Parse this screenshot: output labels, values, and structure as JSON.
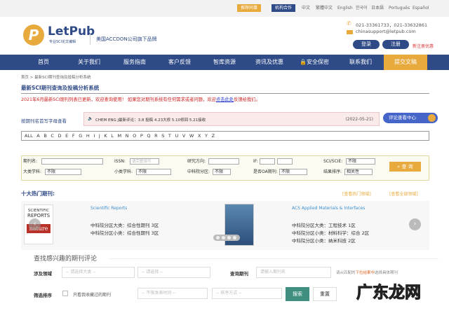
{
  "topbar": {
    "recommend": "推荐同事",
    "institution": "机构合作",
    "langs": [
      "中文",
      "繁體中文",
      "English",
      "한국어",
      "日本語",
      "Português",
      "Español"
    ]
  },
  "header": {
    "logo": "LetPub",
    "logo_sub": "专业SCI论文编辑",
    "brand": "美国ACCDON公司旗下品牌",
    "phone": "021-33361733，021-33632861",
    "email": "chinasupport@letpub.com",
    "login": "登录",
    "register": "注册",
    "promo": "新注册优惠"
  },
  "nav": [
    "首页",
    "关于我们",
    "服务指南",
    "客户反馈",
    "智库资源",
    "资讯及优惠",
    "安全保密",
    "联系我们",
    "提交文稿"
  ],
  "breadcrumb": "首页 > 最新SCI期刊查询及投稿分析系统",
  "page_title": "最新SCI期刊查询及投稿分析系统",
  "notice": {
    "text": "2021年6月最新SCI期刊列表已更新，欢迎查询使用！ 如果您对期刊系统有任何需求或者问题，欢迎",
    "link": "点击此处",
    "tail": "反馈给我们。"
  },
  "review": {
    "label": "按期刊名首写字母查看",
    "text": "CHEM ENG J最新评论：3.8 投稿 4.23大修 5.10修回 5.21接收",
    "date": "(2022-05-21)",
    "center": "评论查看中心"
  },
  "alphabet": [
    "ALL",
    "A",
    "B",
    "C",
    "D",
    "E",
    "F",
    "G",
    "H",
    "I",
    "J",
    "K",
    "L",
    "M",
    "N",
    "O",
    "P",
    "Q",
    "R",
    "S",
    "T",
    "U",
    "V",
    "W",
    "X",
    "Y",
    "Z"
  ],
  "search": {
    "journal": "期刊名:",
    "issn": "ISSN:",
    "issn_ph": "请完整填写",
    "field": "研究方向:",
    "if": "IF:",
    "sci": "SCI/SCIE:",
    "sci_val": "不限",
    "major": "大类学科:",
    "major_val": "不限",
    "minor": "小类学科:",
    "minor_val": "不限",
    "cas": "中科院分区:",
    "cas_val": "不限",
    "oa": "是否OA期刊:",
    "oa_val": "不限",
    "sort": "结果排序:",
    "sort_val": "相关性",
    "query": "查 询"
  },
  "hot": {
    "title": "十大热门期刊:",
    "link1": "[查看热门领域]",
    "link2": "[查看全部领域]",
    "j1": {
      "name": "Scientific Reports",
      "l1": "中科院分区大类：综合性期刊 3区",
      "l2": "中科院分区小类：综合性期刊 3区",
      "cover": [
        "SCIENTIFIC",
        "REPORTS",
        "nature"
      ]
    },
    "j2": {
      "name": "ACS Applied Materials & Interfaces",
      "l1": "中科院分区大类：工程技术 1区",
      "l2": "中科院分区小类：材料科学：综合 2区",
      "l3": "中科院分区小类：纳米科技 2区"
    }
  },
  "find": {
    "title": "查找感兴趣的期刊评论",
    "area": "涉及领域",
    "area1": "-- 请选择大类 --",
    "area2": "-- 请选择 --",
    "query": "查询期刊",
    "query_ph": "请输入期刊名",
    "hint_a": "请从匹配的",
    "hint_b": "下拉结果中",
    "hint_c": "选择具体期刊",
    "filter": "筛选排序",
    "fav": "只看我收藏过的期刊",
    "time": "-- 不限发表时间 --",
    "order": "-- 排序方式 --",
    "search": "搜索",
    "reset": "重置"
  },
  "watermark": "广东龙网"
}
